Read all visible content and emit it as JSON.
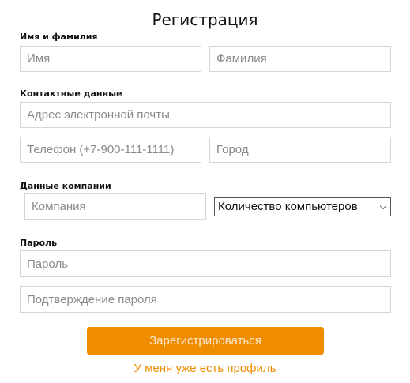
{
  "title": "Регистрация",
  "sections": {
    "name": {
      "label": "Имя и фамилия",
      "first_placeholder": "Имя",
      "last_placeholder": "Фамилия"
    },
    "contact": {
      "label": "Контактные данные",
      "email_placeholder": "Адрес электронной почты",
      "phone_placeholder": "Телефон (+7-900-111-1111)",
      "city_placeholder": "Город"
    },
    "company": {
      "label": "Данные компании",
      "company_placeholder": "Компания",
      "computers_select": "Количество компьютеров"
    },
    "password": {
      "label": "Пароль",
      "password_placeholder": "Пароль",
      "confirm_placeholder": "Подтверждение пароля"
    }
  },
  "submit_label": "Зарегистрироваться",
  "login_link": "У меня уже есть профиль",
  "colors": {
    "accent": "#f08c00"
  }
}
